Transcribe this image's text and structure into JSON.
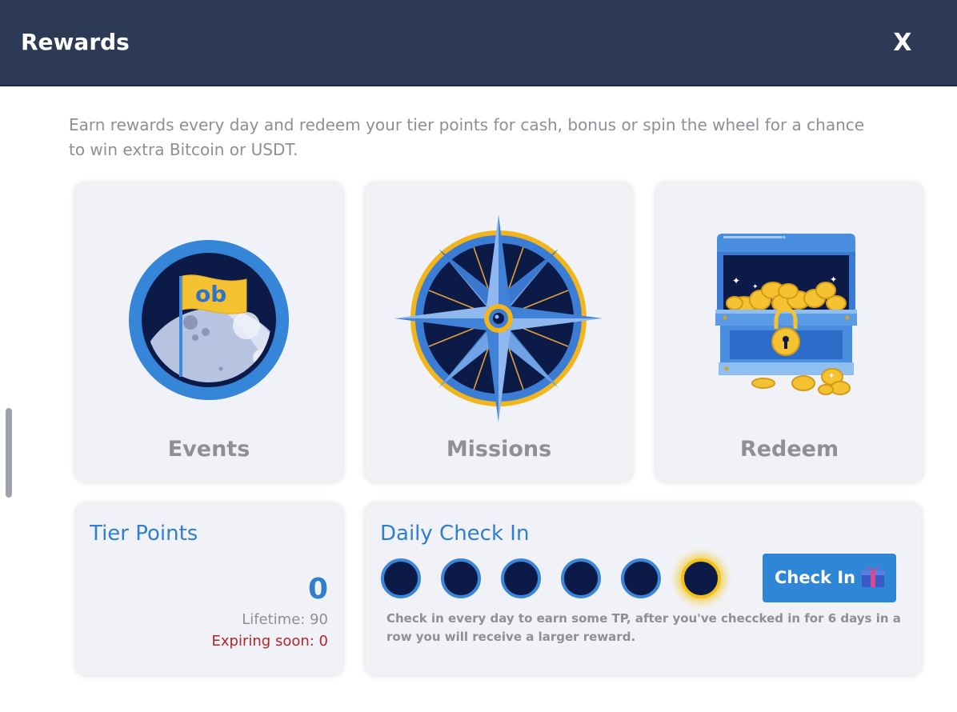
{
  "header": {
    "title": "Rewards",
    "close_label": "X"
  },
  "intro": "Earn rewards every day and redeem your tier points for cash, bonus or spin the wheel for a chance to win extra Bitcoin or USDT.",
  "cards": {
    "events": {
      "label": "Events",
      "flag_text": "ob"
    },
    "missions": {
      "label": "Missions"
    },
    "redeem": {
      "label": "Redeem"
    }
  },
  "tier_points": {
    "title": "Tier Points",
    "value": "0",
    "lifetime": "Lifetime: 90",
    "expiring": "Expiring soon: 0"
  },
  "daily_check_in": {
    "title": "Daily Check In",
    "days_count": 6,
    "current_day": 6,
    "button_label": "Check In",
    "note": "Check in every day to earn some TP, after you've checcked in for 6 days in a row you will receive a larger reward."
  },
  "colors": {
    "header_bg": "#2d3a56",
    "accent_blue": "#2f7fcf",
    "button_blue": "#2f85d6",
    "expiring_red": "#b0262a",
    "dot_fill": "#0c1a47",
    "glow_yellow": "#f2c21b"
  }
}
